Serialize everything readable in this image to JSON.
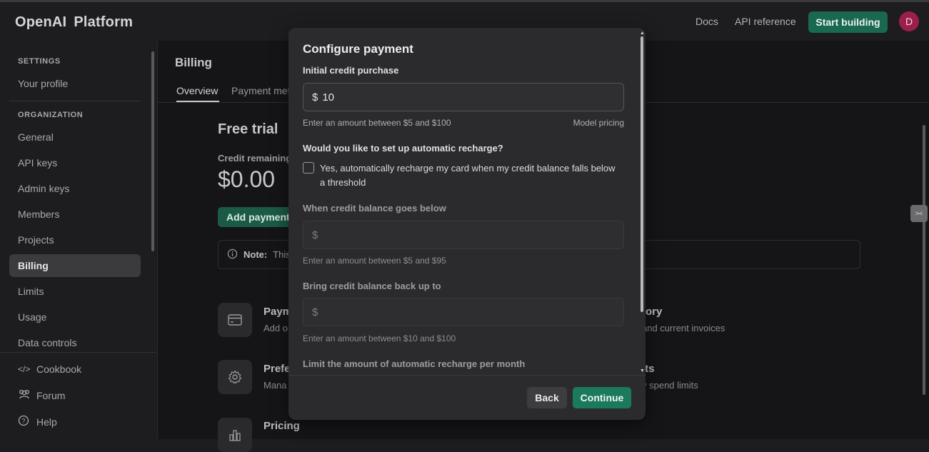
{
  "header": {
    "logo_primary": "OpenAI",
    "logo_secondary": "Platform",
    "links": [
      "Docs",
      "API reference"
    ],
    "start_button": "Start building",
    "avatar_initial": "D"
  },
  "sidebar": {
    "settings_heading": "SETTINGS",
    "profile": "Your profile",
    "org_heading": "ORGANIZATION",
    "items": [
      "General",
      "API keys",
      "Admin keys",
      "Members",
      "Projects",
      "Billing",
      "Limits",
      "Usage",
      "Data controls"
    ],
    "active": "Billing",
    "footer": [
      "Cookbook",
      "Forum",
      "Help"
    ]
  },
  "main": {
    "title": "Billing",
    "tabs": [
      "Overview",
      "Payment met"
    ],
    "free_trial": "Free trial",
    "credit_label": "Credit remaining",
    "credit_value": "$0.00",
    "add_payment": "Add payment",
    "note_bold": "Note:",
    "note_text": "This",
    "cards": [
      {
        "title": "Paym",
        "sub": "Add o"
      },
      {
        "title": "tory",
        "sub": "and current invoices"
      },
      {
        "title": "Prefe",
        "sub": "Mana"
      },
      {
        "title": "its",
        "sub": "y spend limits"
      },
      {
        "title": "Pricing",
        "sub": ""
      }
    ]
  },
  "modal": {
    "title": "Configure payment",
    "initial_label": "Initial credit purchase",
    "currency": "$",
    "initial_value": "10",
    "initial_hint": "Enter an amount between $5 and $100",
    "model_pricing": "Model pricing",
    "recharge_question": "Would you like to set up automatic recharge?",
    "recharge_checkbox": "Yes, automatically recharge my card when my credit balance falls below a threshold",
    "below_label": "When credit balance goes below",
    "below_hint": "Enter an amount between $5 and $95",
    "back_up_label": "Bring credit balance back up to",
    "back_up_hint": "Enter an amount between $10 and $100",
    "limit_label": "Limit the amount of automatic recharge per month",
    "back_button": "Back",
    "continue_button": "Continue"
  },
  "colors": {
    "accent": "#19684f",
    "continue": "#1b7a5c",
    "avatar": "#9a1f4a"
  }
}
